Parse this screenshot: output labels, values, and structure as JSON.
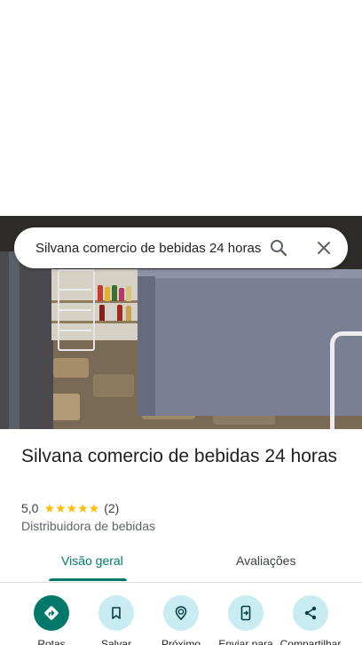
{
  "search": {
    "query": "Silvana comercio de bebidas 24 horas"
  },
  "place": {
    "title": "Silvana comercio de bebidas 24 horas",
    "rating": "5,0",
    "stars": "★★★★★",
    "review_count": "(2)",
    "category": "Distribuidora de bebidas"
  },
  "tabs": [
    {
      "label": "Visão geral",
      "active": true
    },
    {
      "label": "Avaliações",
      "active": false
    }
  ],
  "actions": [
    {
      "label": "Rotas",
      "icon": "directions-icon"
    },
    {
      "label": "Salvar",
      "icon": "bookmark-icon"
    },
    {
      "label": "Próximo",
      "icon": "nearby-icon"
    },
    {
      "label": "Enviar para",
      "icon": "send-to-phone-icon"
    },
    {
      "label": "Compartilhar",
      "icon": "share-icon"
    }
  ],
  "colors": {
    "accent": "#00796b",
    "action_bg": "#c8ecf2",
    "star": "#fbbc04"
  }
}
